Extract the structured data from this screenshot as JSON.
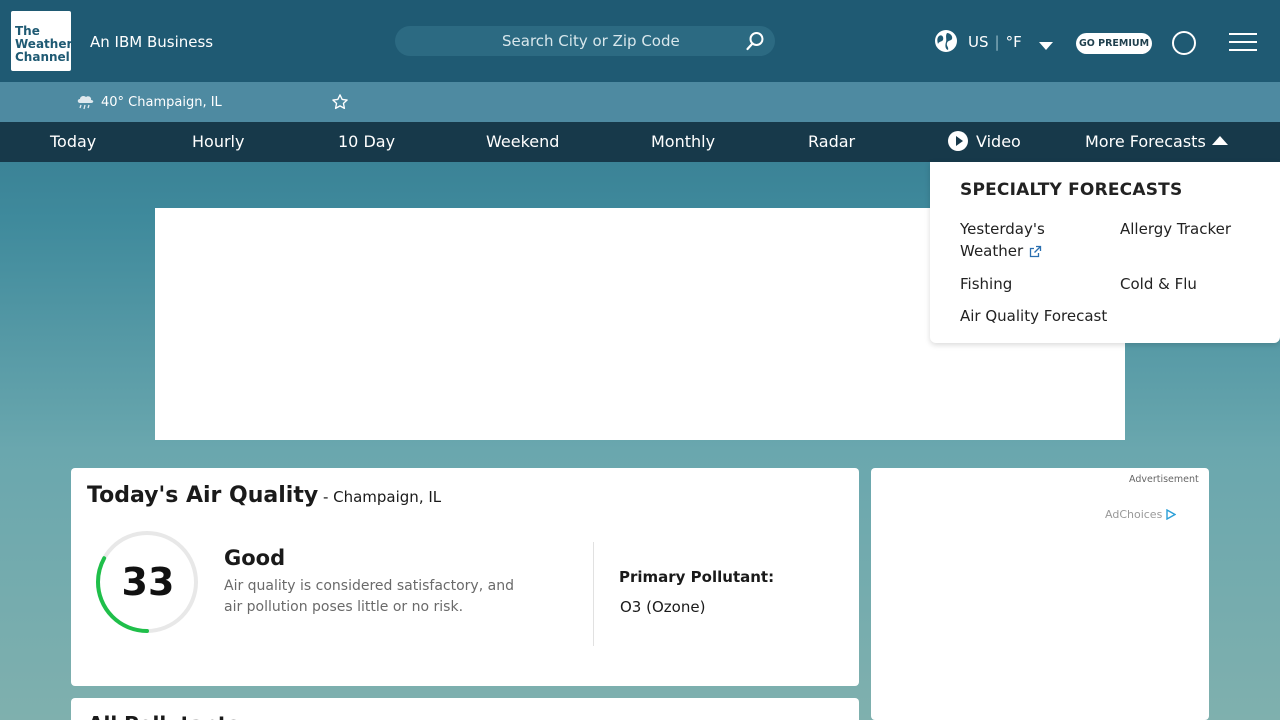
{
  "header": {
    "logo_lines": [
      "The",
      "Weather",
      "Channel"
    ],
    "ibm_text": "An IBM Business",
    "search_placeholder": "Search City or Zip Code",
    "units": {
      "system": "US",
      "separator": "|",
      "temp": "°F"
    },
    "premium_label": "GO PREMIUM"
  },
  "location_bar": {
    "location_text": "40° Champaign, IL"
  },
  "nav": {
    "items": [
      "Today",
      "Hourly",
      "10 Day",
      "Weekend",
      "Monthly",
      "Radar",
      "Video",
      "More Forecasts"
    ]
  },
  "dropdown": {
    "title": "SPECIALTY FORECASTS",
    "items": {
      "yesterdays_weather_line1": "Yesterday's",
      "yesterdays_weather_line2": "Weather",
      "allergy_tracker": "Allergy Tracker",
      "fishing": "Fishing",
      "cold_flu": "Cold & Flu",
      "air_quality_forecast": "Air Quality Forecast"
    }
  },
  "air_quality": {
    "title": "Today's Air Quality",
    "location": " - Champaign, IL",
    "index_value": "33",
    "index_fraction": 0.33,
    "category": "Good",
    "description": "Air quality is considered satisfactory, and air pollution poses little or no risk.",
    "primary_pollutant_label": "Primary Pollutant:",
    "primary_pollutant_value": "O3 (Ozone)",
    "gauge_color": "#1fbf4a"
  },
  "side_ad": {
    "advertisement_label": "Advertisement",
    "adchoices_label": "AdChoices"
  },
  "bottom_card": {
    "title": "All Pollutants"
  },
  "colors": {
    "header_bg": "#1f5a73",
    "nav_bg": "#17394a",
    "location_bar_bg": "#4e8aa1"
  }
}
